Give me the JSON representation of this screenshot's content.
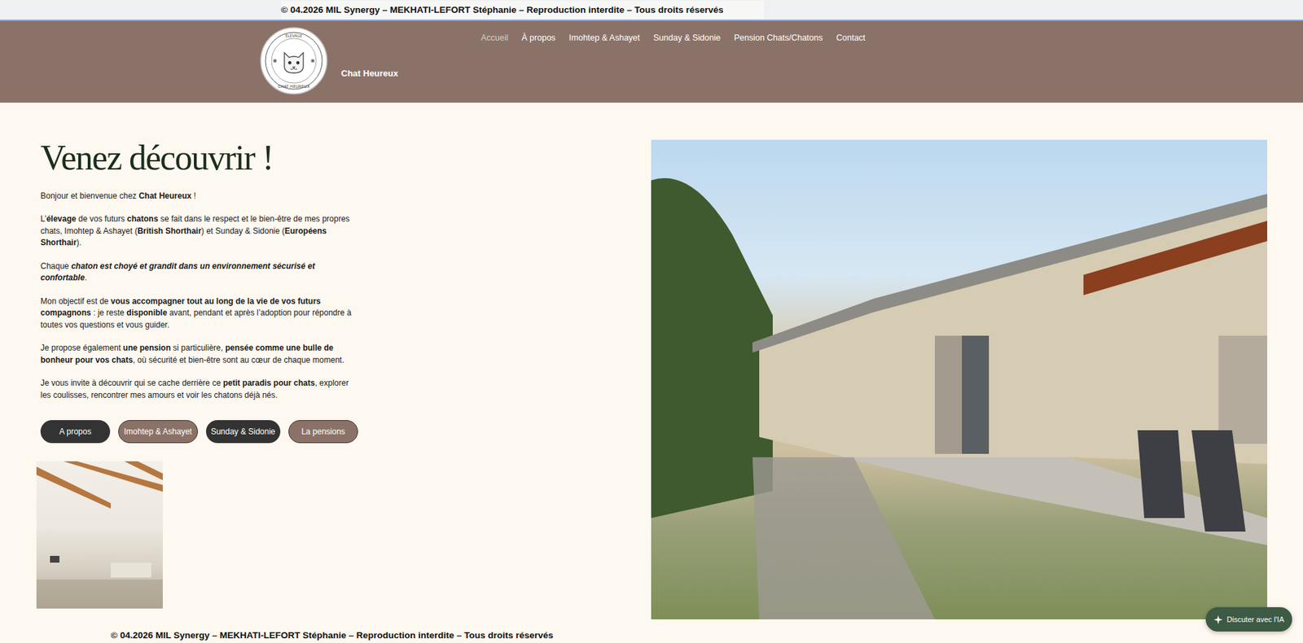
{
  "topbar": {
    "text": "© 04.2026 MIL Synergy – MEKHATI-LEFORT Stéphanie – Reproduction interdite – Tous droits réservés"
  },
  "header": {
    "logo": {
      "top": "ÉLEVAGE",
      "bottom": "CHAT HEUREUX"
    },
    "site_name": "Chat Heureux"
  },
  "nav": [
    {
      "label": "Accueil",
      "selected": true
    },
    {
      "label": "À propos",
      "selected": false
    },
    {
      "label": "Imohtep & Ashayet",
      "selected": false
    },
    {
      "label": "Sunday & Sidonie",
      "selected": false
    },
    {
      "label": "Pension Chats/Chatons",
      "selected": false
    },
    {
      "label": "Contact",
      "selected": false
    }
  ],
  "heading": "Venez découvrir !",
  "paragraphs": [
    [
      {
        "text": "Bonjour et bienvenue chez ",
        "kind": "plain"
      },
      {
        "text": "Chat Heureux",
        "kind": "bold"
      },
      {
        "text": " !",
        "kind": "plain"
      }
    ],
    [
      {
        "text": "L’",
        "kind": "plain"
      },
      {
        "text": "élevage",
        "kind": "bold"
      },
      {
        "text": " de vos futurs ",
        "kind": "plain"
      },
      {
        "text": "chatons",
        "kind": "bold"
      },
      {
        "text": " se fait dans le respect et le bien-être de mes propres chats, Imohtep & Ashayet (",
        "kind": "plain"
      },
      {
        "text": "British Shorthair",
        "kind": "bold"
      },
      {
        "text": ") et Sunday & Sidonie (",
        "kind": "plain"
      },
      {
        "text": "Européens Shorthair",
        "kind": "bold"
      },
      {
        "text": ").",
        "kind": "plain"
      }
    ],
    [
      {
        "text": "Chaque ",
        "kind": "plain"
      },
      {
        "text": "chaton est choyé et grandit dans un environnement sécurisé et confortable",
        "kind": "bolditalic"
      },
      {
        "text": ".",
        "kind": "plain"
      }
    ],
    [
      {
        "text": "Mon objectif est de ",
        "kind": "plain"
      },
      {
        "text": "vous accompagner tout au long de la vie de vos futurs compagnons",
        "kind": "bold"
      },
      {
        "text": " : je reste ",
        "kind": "plain"
      },
      {
        "text": "disponible",
        "kind": "bold"
      },
      {
        "text": " avant, pendant et après l’adoption pour répondre à toutes vos questions et vous guider.",
        "kind": "plain"
      }
    ],
    [
      {
        "text": "Je propose également ",
        "kind": "plain"
      },
      {
        "text": "une pension",
        "kind": "bold"
      },
      {
        "text": " si particulière, ",
        "kind": "plain"
      },
      {
        "text": "pensée comme une bulle de bonheur pour vos chats",
        "kind": "bold"
      },
      {
        "text": ", où sécurité et bien-être sont au cœur de chaque moment.",
        "kind": "plain"
      }
    ],
    [
      {
        "text": "Je vous invite à découvrir qui se cache derrière ce ",
        "kind": "plain"
      },
      {
        "text": "petit paradis pour chats",
        "kind": "bold"
      },
      {
        "text": ", explorer les coulisses, rencontrer mes amours et voir les chatons déjà nés.",
        "kind": "plain"
      }
    ]
  ],
  "buttons": [
    {
      "label": "A propos",
      "kind": "dark"
    },
    {
      "label": "Imohtep & Ashayet",
      "kind": "brown"
    },
    {
      "label": "Sunday & Sidonie",
      "kind": "dark"
    },
    {
      "label": "La pensions",
      "kind": "brown"
    }
  ],
  "footer": {
    "text": "© 04.2026 MIL Synergy – MEKHATI-LEFORT Stéphanie – Reproduction interdite – Tous droits réservés"
  },
  "chat_button": {
    "label": "Discuter avec l'IA"
  }
}
